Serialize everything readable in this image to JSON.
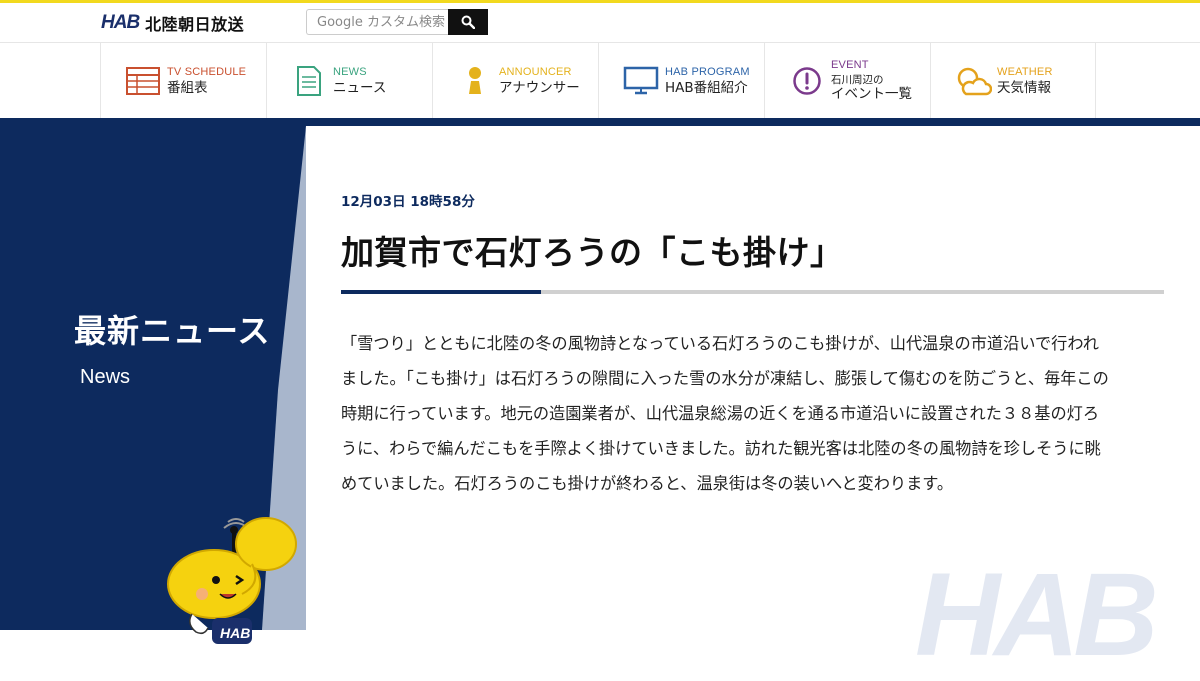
{
  "header": {
    "logo_mark": "HAB",
    "logo_text": "北陸朝日放送",
    "search_placeholder": "Google カスタム検索"
  },
  "nav": [
    {
      "en": "TV SCHEDULE",
      "ja": "番組表",
      "color": "#c9502f",
      "icon": "tv-schedule-icon"
    },
    {
      "en": "NEWS",
      "ja": "ニュース",
      "color": "#3aa37f",
      "icon": "news-icon"
    },
    {
      "en": "ANNOUNCER",
      "ja": "アナウンサー",
      "color": "#e4b21c",
      "icon": "announcer-icon"
    },
    {
      "en": "HAB PROGRAM",
      "ja": "HAB番組紹介",
      "color": "#2d64a8",
      "icon": "monitor-icon"
    },
    {
      "en": "EVENT",
      "ja1": "石川周辺の",
      "ja2": "イベント一覧",
      "color": "#7b3a8c",
      "icon": "event-icon"
    },
    {
      "en": "WEATHER",
      "ja": "天気情報",
      "color": "#e4a21c",
      "icon": "weather-icon"
    }
  ],
  "sidebar": {
    "title": "最新ニュース",
    "subtitle": "News"
  },
  "article": {
    "date": "12月03日 18時58分",
    "title": "加賀市で石灯ろうの「こも掛け」",
    "body": "「雪つり」とともに北陸の冬の風物詩となっている石灯ろうのこも掛けが、山代温泉の市道沿いで行われました。「こも掛け」は石灯ろうの隙間に入った雪の水分が凍結し、膨張して傷むのを防ごうと、毎年この時期に行っています。地元の造園業者が、山代温泉総湯の近くを通る市道沿いに設置された３８基の灯ろうに、わらで編んだこもを手際よく掛けていきました。訪れた観光客は北陸の冬の風物詩を珍しそうに眺めていました。石灯ろうのこも掛けが終わると、温泉街は冬の装いへと変わります。"
  },
  "watermark": "HAB",
  "colors": {
    "navy": "#0d2a5e",
    "yellow": "#f2d91e"
  }
}
